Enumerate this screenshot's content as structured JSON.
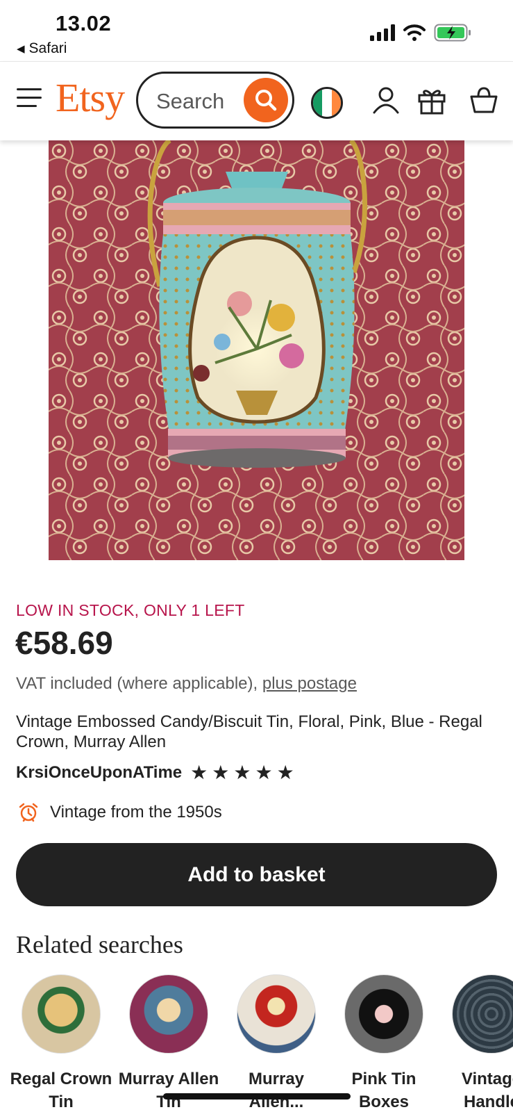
{
  "status_bar": {
    "time": "13.02",
    "back_app": "Safari"
  },
  "header": {
    "logo": "Etsy",
    "search_placeholder": "Search",
    "flag_colors": [
      "#169b62",
      "#ffffff",
      "#ff883e"
    ]
  },
  "product": {
    "image_count": 9,
    "active_image": 1,
    "stock_notice": "LOW IN STOCK, ONLY 1 LEFT",
    "price": "€58.69",
    "vat_text": "VAT included (where applicable), ",
    "postage_link": "plus postage",
    "title": "Vintage Embossed Candy/Biscuit Tin, Floral, Pink, Blue - Regal Crown, Murray Allen",
    "seller": "KrsiOnceUponATime",
    "rating": 5,
    "vintage_note": "Vintage from the 1950s",
    "add_to_basket": "Add to basket"
  },
  "related": {
    "heading": "Related searches",
    "items": [
      {
        "label": "Regal Crown Tin"
      },
      {
        "label": "Murray Allen Tin"
      },
      {
        "label": "Murray Allen..."
      },
      {
        "label": "Pink Tin Boxes"
      },
      {
        "label": "Vintage Handle"
      }
    ]
  },
  "colors": {
    "brand_orange": "#f1641e",
    "stock_red": "#b7144b",
    "dark": "#222222"
  }
}
